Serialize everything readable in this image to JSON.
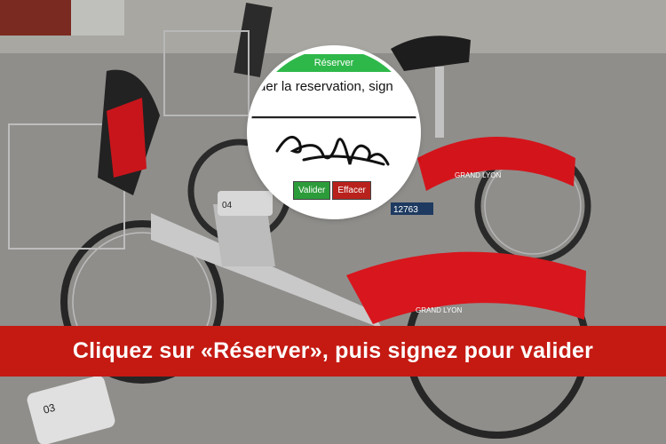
{
  "popup": {
    "header": "Réserver",
    "instruction": "alider la reservation, sign",
    "validate_label": "Valider",
    "clear_label": "Effacer"
  },
  "photo": {
    "bike_number_front": "04",
    "bike_number_rear": "03",
    "bike_id": "12763",
    "brand": "GRAND LYON"
  },
  "banner": {
    "text": "Cliquez sur «Réserver», puis signez pour valider"
  },
  "colors": {
    "banner_red": "#c41a12",
    "header_green": "#2fb84a",
    "validate_green": "#2c9b3a",
    "clear_red": "#b8211c"
  }
}
